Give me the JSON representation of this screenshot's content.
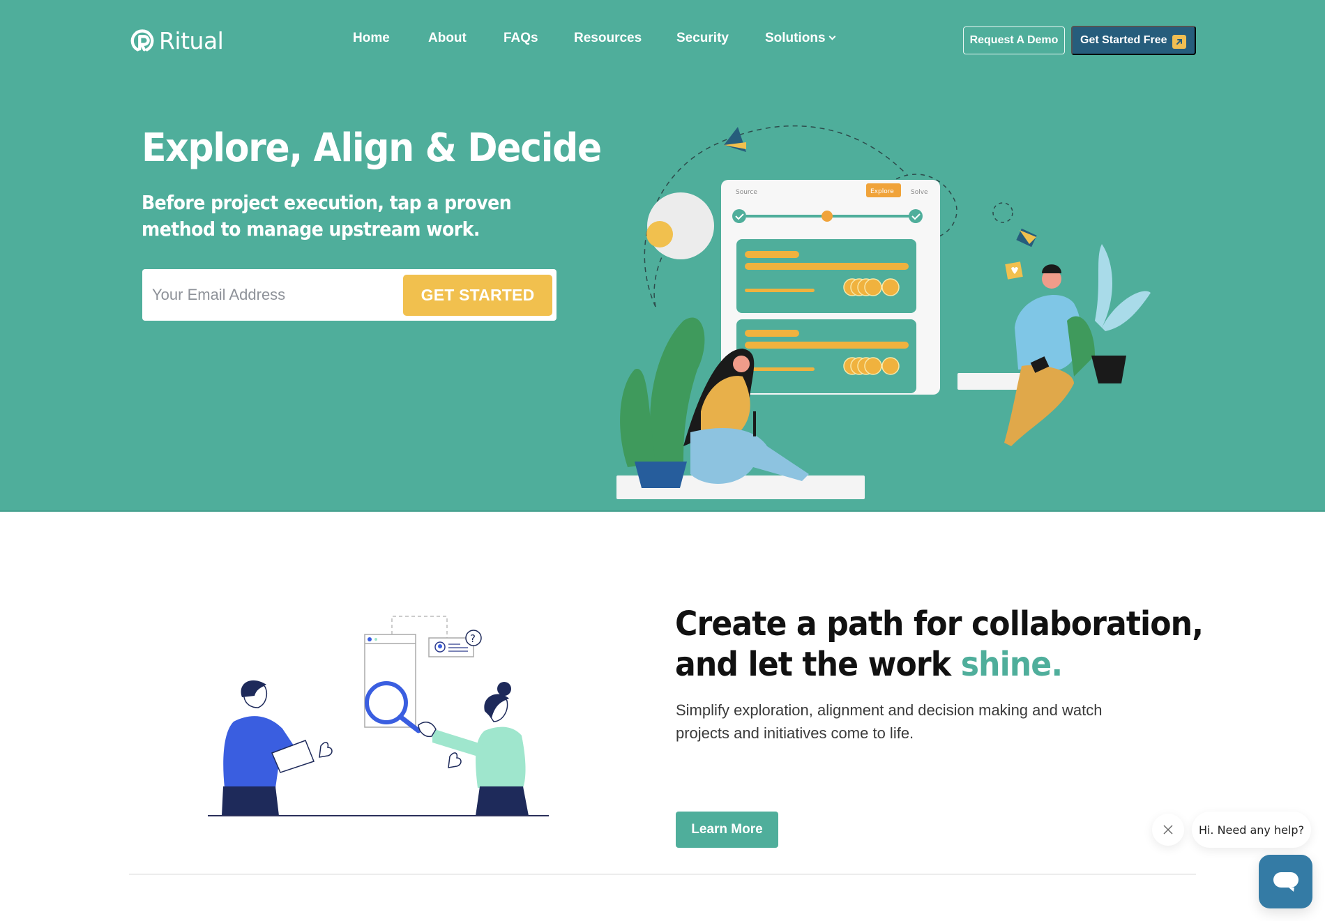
{
  "colors": {
    "brand_teal": "#4fae9b",
    "navy_button": "#265d7c",
    "cta_yellow": "#f1c04e",
    "chat_blue": "#347ba5"
  },
  "header": {
    "logo_text": "Ritual",
    "logo_icon": "ritual-logo-icon",
    "nav": [
      {
        "label": "Home"
      },
      {
        "label": "About"
      },
      {
        "label": "FAQs"
      },
      {
        "label": "Resources"
      },
      {
        "label": "Security"
      },
      {
        "label": "Solutions",
        "icon": "chevron-down-icon"
      }
    ],
    "request_demo_label": "Request A Demo",
    "get_started_free_label": "Get Started Free",
    "get_started_free_icon": "arrow-up-right-icon"
  },
  "hero": {
    "title": "Explore, Align & Decide",
    "subtitle": "Before project execution, tap a proven method to manage upstream work.",
    "email_placeholder": "Your Email Address",
    "email_value": "",
    "cta_label": "GET STARTED",
    "illustration": {
      "steps": [
        "Source",
        "Explore",
        "Solve"
      ],
      "active_step": "Explore",
      "completed_steps": [
        "Source",
        "Solve"
      ]
    }
  },
  "section2": {
    "title_line1": "Create a path for collaboration,",
    "title_line2_prefix": "and let the work ",
    "title_accent": "shine.",
    "body": "Simplify exploration, alignment and decision making and watch projects and initiatives come to life.",
    "learn_more_label": "Learn More"
  },
  "chat": {
    "greeting": "Hi. Need any help?",
    "close_icon": "close-icon",
    "launcher_icon": "chat-bubble-icon"
  }
}
